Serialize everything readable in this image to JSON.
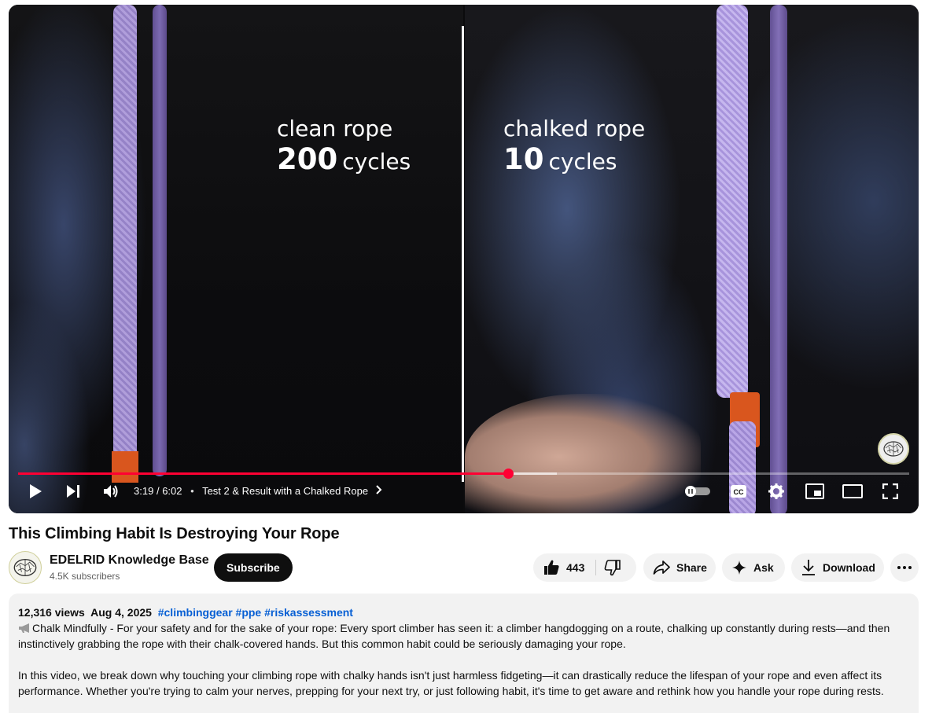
{
  "player": {
    "overlay": {
      "left_line1": "clean rope",
      "left_num": "200",
      "left_word": "cycles",
      "right_line1": "chalked rope",
      "right_num": "10",
      "right_word": "cycles"
    },
    "progress_fraction": 0.55,
    "buffered_fraction": 0.605,
    "time_current": "3:19",
    "time_total": "6:02",
    "time_sep": "/",
    "chapter": "Test 2 & Result with a Chalked Rope",
    "cc_label": "CC"
  },
  "video": {
    "title": "This Climbing Habit Is Destroying Your Rope",
    "channel": "EDELRID Knowledge Base",
    "subscribers": "4.5K subscribers",
    "subscribe_label": "Subscribe",
    "likes": "443",
    "share_label": "Share",
    "ask_label": "Ask",
    "download_label": "Download"
  },
  "description": {
    "views": "12,316 views",
    "date": "Aug 4, 2025",
    "tags": "#climbinggear #ppe #riskassessment",
    "para1": "Chalk Mindfully - For your safety and for the sake of your rope: Every sport climber has seen it: a climber hangdogging on a route, chalking up constantly during rests—and then instinctively grabbing the rope with their chalk-covered hands. But this common habit could be seriously damaging your rope.",
    "para2": "In this video, we break down why touching your climbing rope with chalky hands isn't just harmless fidgeting—it can drastically reduce the lifespan of your rope and even affect its performance. Whether you're trying to calm your nerves, prepping for your next try, or just following habit, it's time to get aware and rethink how you handle your rope during rests."
  },
  "icons": {
    "play": "play-icon",
    "next": "next-icon",
    "volume": "volume-icon",
    "autoplay": "autoplay-toggle-icon",
    "cc": "cc-icon",
    "settings": "gear-icon",
    "miniplayer": "miniplayer-icon",
    "theater": "theater-icon",
    "fullscreen": "fullscreen-icon",
    "like": "thumbs-up-icon",
    "dislike": "thumbs-down-icon",
    "share": "share-icon",
    "ask": "sparkle-icon",
    "download": "download-icon",
    "more": "more-icon"
  },
  "colors": {
    "progress": "#ff0033",
    "link": "#065fd4",
    "subscribe_bg": "#0f0f0f",
    "pill_bg": "#f2f2f2"
  }
}
